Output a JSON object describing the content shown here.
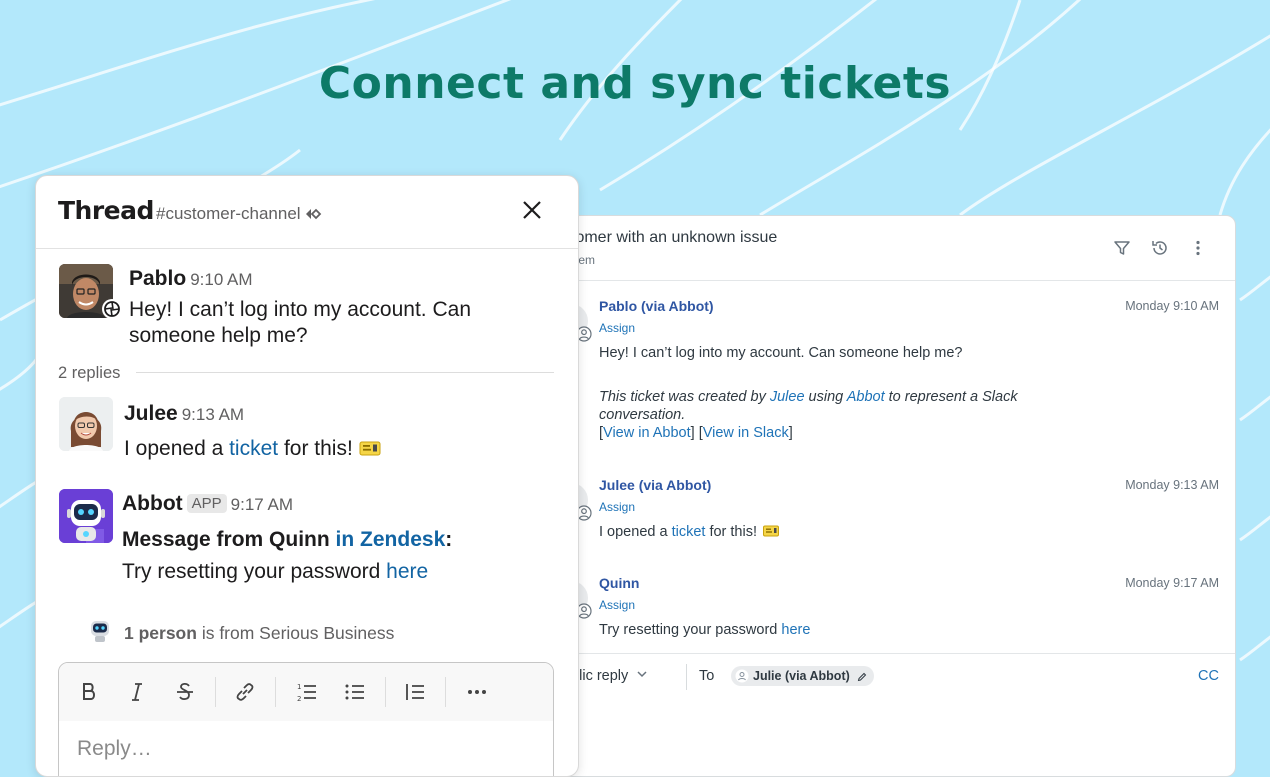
{
  "headline": "Connect and sync tickets",
  "zendesk": {
    "ticket_title": "stomer with an unknown issue",
    "ticket_subtitle": "ystem",
    "header_icons": [
      "filter-icon",
      "history-icon",
      "more-vertical-icon"
    ],
    "messages": [
      {
        "author": "Pablo (via Abbot)",
        "time": "Monday 9:10 AM",
        "assign": "Assign",
        "text": "Hey! I can’t log into my account. Can someone help me?",
        "note_prefix": "This ticket was created by ",
        "note_user": "Julee",
        "note_mid": " using ",
        "note_app": "Abbot",
        "note_suffix": " to represent a Slack",
        "note_line2": "conversation.",
        "link_abbot": "View in Abbot",
        "link_slack": "View in Slack"
      },
      {
        "author": "Julee (via Abbot)",
        "time": "Monday 9:13 AM",
        "assign": "Assign",
        "text_before": "I opened a ",
        "text_link": "ticket",
        "text_after": " for this! "
      },
      {
        "author": "Quinn",
        "time": "Monday 9:17 AM",
        "assign": "Assign",
        "text_before": "Try resetting your password ",
        "text_link": "here"
      }
    ],
    "footer": {
      "reply_mode": "ublic reply",
      "to_label": "To",
      "recipient": "Julie (via Abbot)",
      "cc": "CC"
    }
  },
  "slack": {
    "title": "Thread",
    "channel": "#customer-channel",
    "root": {
      "author": "Pablo",
      "time": "9:10 AM",
      "text": "Hey! I can’t log into my account. Can someone help me?"
    },
    "replies_count": "2 replies",
    "reply1": {
      "author": "Julee",
      "time": "9:13 AM",
      "text_before": "I opened a ",
      "text_link": "ticket",
      "text_after": " for this! "
    },
    "reply2": {
      "author": "Abbot",
      "badge": "APP",
      "time": "9:17 AM",
      "bold_prefix": "Message from Quinn",
      "bold_link": "in Zendesk",
      "bold_colon": ":",
      "text_before": "Try resetting your password ",
      "text_link": "here"
    },
    "people_count": "1 person",
    "people_suffix": " is from Serious Business",
    "composer": {
      "placeholder": "Reply…",
      "tools": [
        "bold-icon",
        "italic-icon",
        "strikethrough-icon",
        "link-icon",
        "ordered-list-icon",
        "bulleted-list-icon",
        "blockquote-icon",
        "more-horizontal-icon"
      ]
    }
  }
}
